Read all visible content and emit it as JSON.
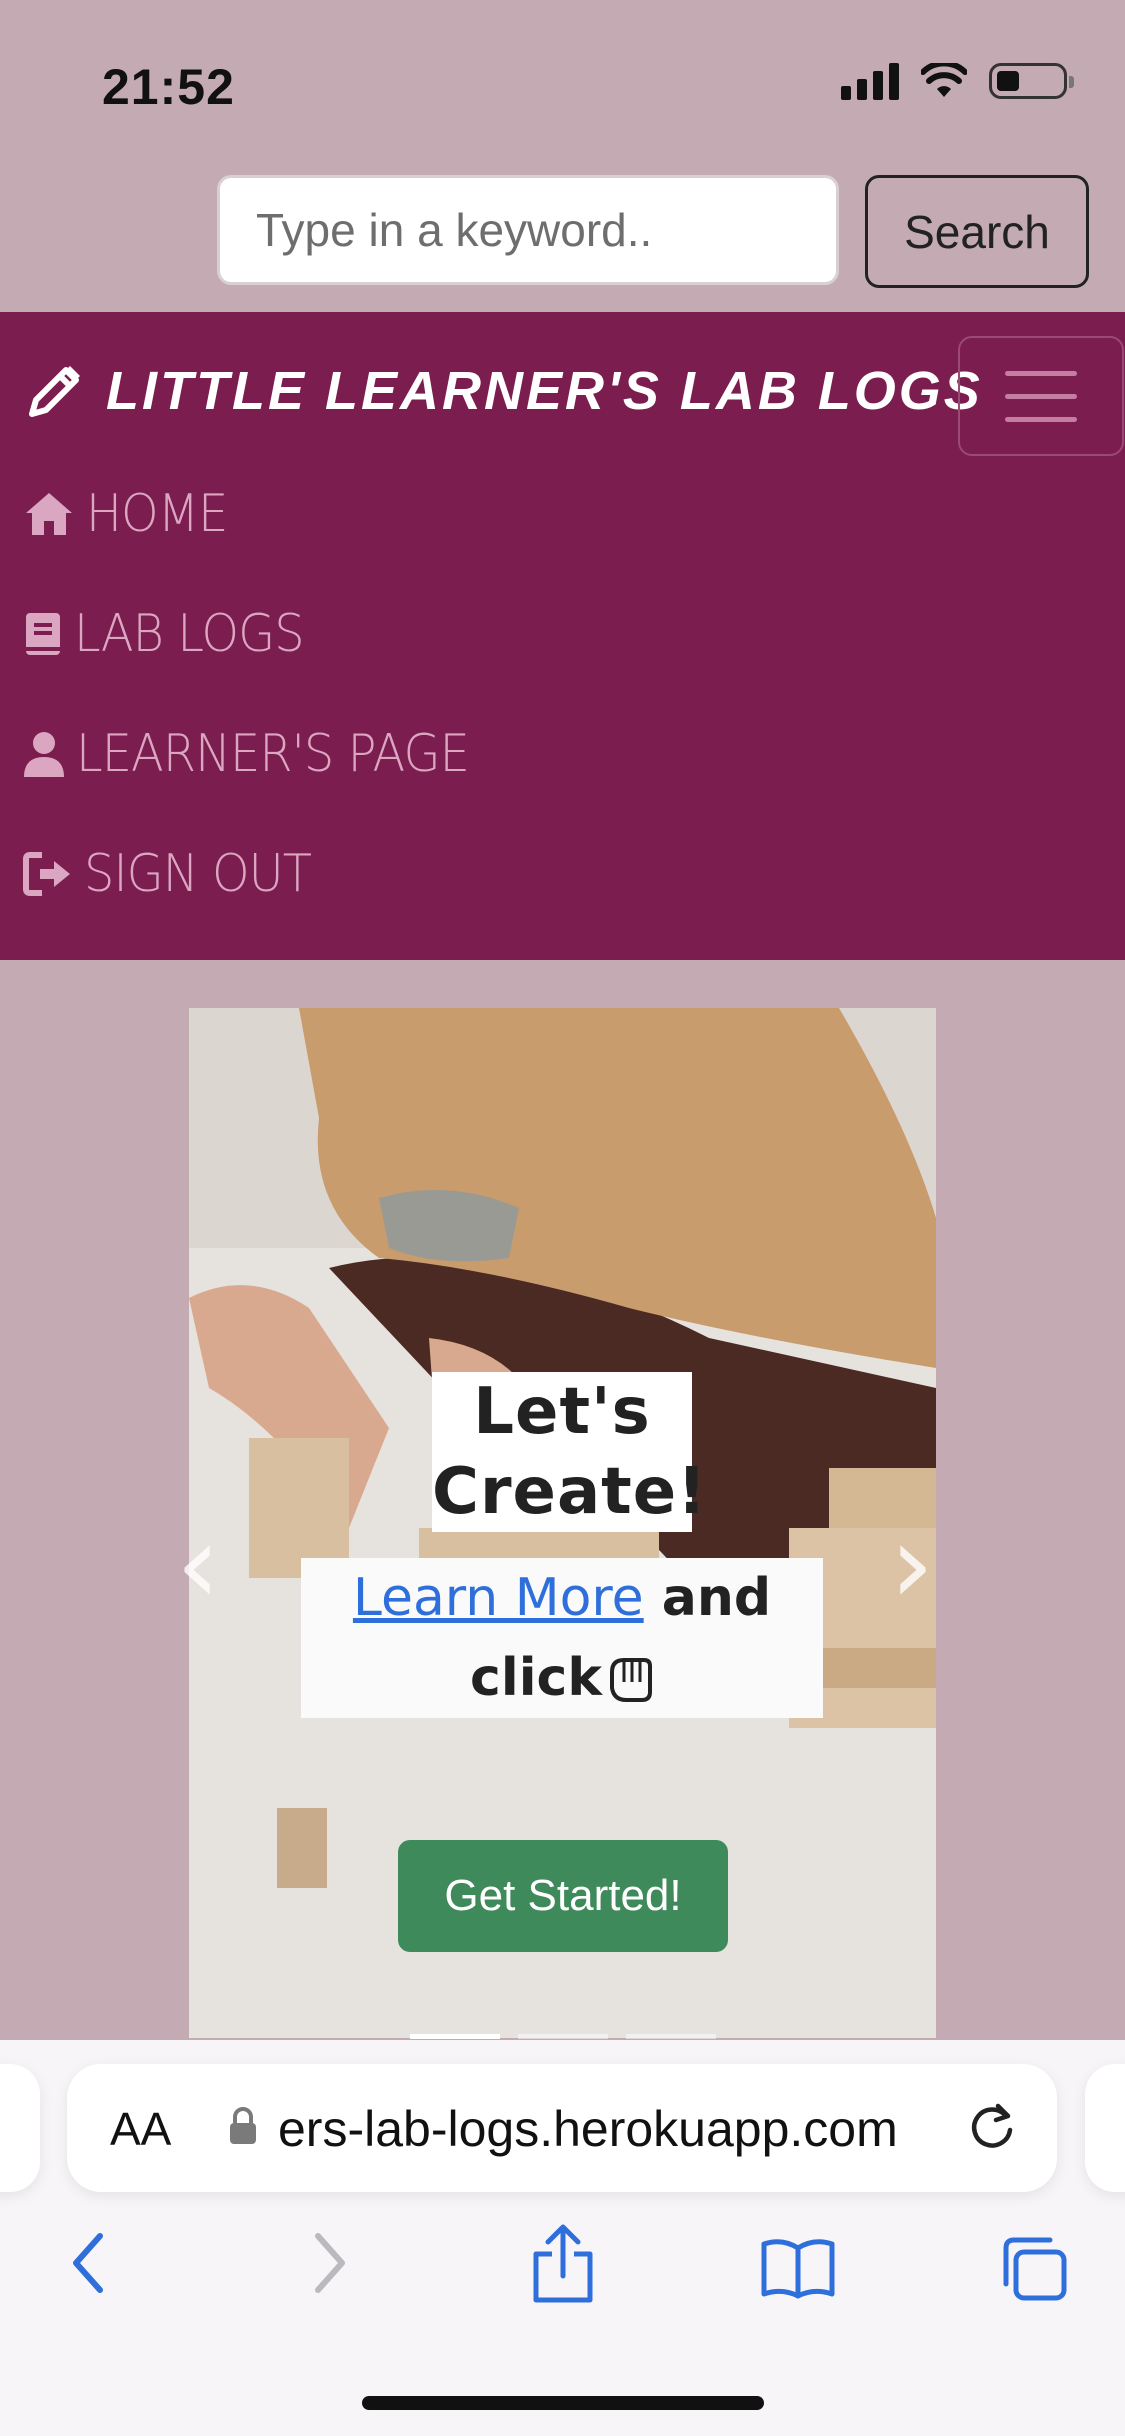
{
  "status": {
    "time": "21:52"
  },
  "search": {
    "placeholder": "Type in a keyword..",
    "button_label": "Search"
  },
  "navbar": {
    "brand": "LITTLE LEARNER'S LAB LOGS",
    "items": [
      {
        "label": "HOME",
        "icon": "home-icon"
      },
      {
        "label": "LAB LOGS",
        "icon": "book-icon"
      },
      {
        "label": "LEARNER'S PAGE",
        "icon": "user-icon"
      },
      {
        "label": "SIGN OUT",
        "icon": "sign-out-icon"
      }
    ]
  },
  "hero": {
    "title_line1": "Let's",
    "title_line2": "Create!",
    "link_text": "Learn More",
    "sub_text_after_link": " and",
    "sub_text_line2": "click",
    "button_label": "Get Started!"
  },
  "browser": {
    "aa_label": "AA",
    "url": "ers-lab-logs.herokuapp.com"
  },
  "colors": {
    "navbar": "#7b1d4e",
    "page_bg": "#c3aab3",
    "nav_link": "#dba6c2",
    "button_green": "#3f8a5a"
  }
}
